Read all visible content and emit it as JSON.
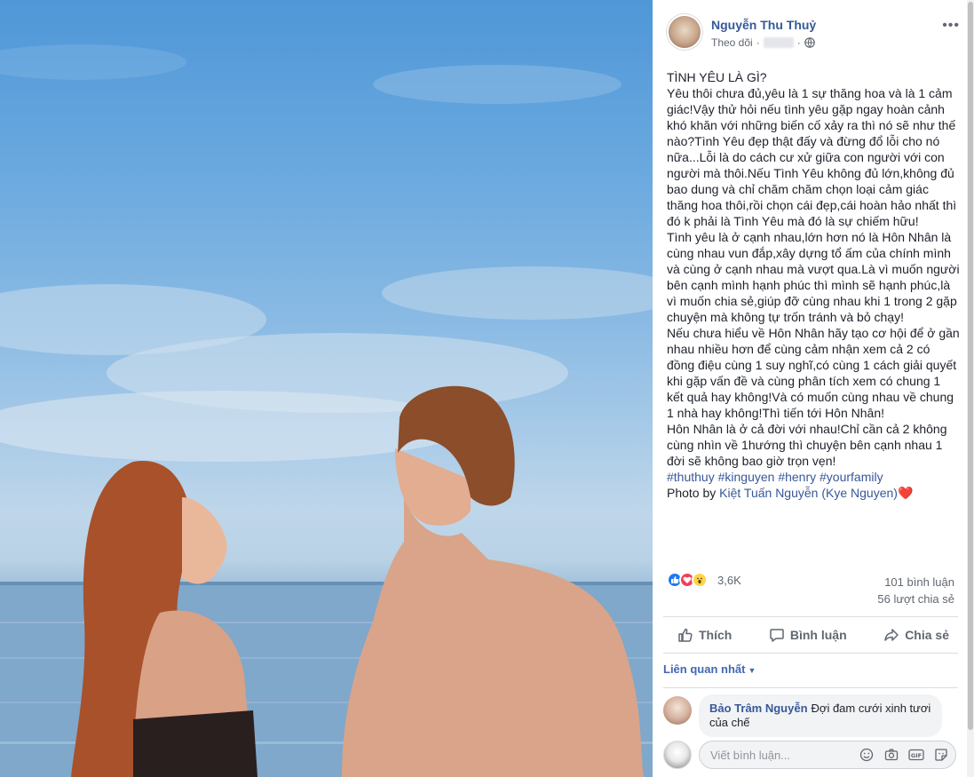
{
  "post": {
    "author": "Nguyễn Thu Thuỷ",
    "follow_label": "Theo dõi",
    "text": {
      "title": "TÌNH YÊU LÀ GÌ?",
      "p1": "Yêu thôi chưa đủ,yêu là 1 sự thăng hoa và là 1 cảm giác!Vậy thử hỏi nếu tình yêu gặp ngay hoàn cảnh khó khăn với những biến cố xảy ra thì nó sẽ như thế nào?Tình Yêu đẹp thật đấy và đừng đổ lỗi cho nó nữa...Lỗi là do cách cư xử giữa con người với con người mà thôi.Nếu Tình Yêu không đủ lớn,không đủ bao dung và chỉ chăm chăm chọn loại cảm giác thăng hoa thôi,rồi chọn cái đẹp,cái hoàn hảo nhất thì đó k phải là Tình Yêu mà đó là sự chiếm hữu!",
      "p2": "Tình yêu là ở cạnh nhau,lớn hơn nó là Hôn Nhân là cùng nhau vun đắp,xây dựng tổ ấm của chính mình và cùng ở cạnh nhau mà vượt qua.Là vì muốn người bên cạnh mình hạnh phúc thì mình sẽ hạnh phúc,là vì muốn chia sẻ,giúp đỡ cùng nhau khi 1 trong 2 gặp chuyện mà không tự trốn tránh và bỏ chạy!",
      "p3": "Nếu chưa hiểu về Hôn Nhân hãy tạo cơ hội để ở gần nhau nhiều hơn để cùng cảm nhận xem cả 2 có đồng điệu cùng 1 suy nghĩ,có cùng 1 cách giải quyết khi gặp vấn đề và cùng phân tích xem có chung 1 kết quả hay không!Và có muốn cùng nhau về chung 1 nhà hay không!Thì tiến tới Hôn Nhân!",
      "p4": "Hôn Nhân là ở cả đời với nhau!Chỉ cần cả 2 không cùng nhìn về 1hướng thì chuyện bên cạnh nhau 1 đời sẽ không bao giờ trọn vẹn!",
      "hashtags": "#thuthuy #kinguyen #henry #yourfamily",
      "photo_by_prefix": "Photo by ",
      "photo_by_name": "Kiệt Tuấn Nguyễn (Kye Nguyen)",
      "heart": "❤️"
    },
    "reactions_count": "3,6K",
    "comments_count": "101 bình luận",
    "shares_count": "56 lượt chia sẻ"
  },
  "actions": {
    "like": "Thích",
    "comment": "Bình luận",
    "share": "Chia sẻ"
  },
  "comments": {
    "sort_label": "Liên quan nhất",
    "items": [
      {
        "author": "Bảo Trâm Nguyễn",
        "text": "Đợi đam cưới xinh tươi của chế"
      }
    ],
    "input_placeholder": "Viết bình luận..."
  },
  "colors": {
    "link": "#365899",
    "like_blue": "#2078f4",
    "love_red": "#f33e58",
    "wow_yellow": "#fcd54c"
  },
  "icons": [
    "globe-icon",
    "more-icon",
    "like-icon",
    "comment-icon",
    "share-icon",
    "emoji-icon",
    "camera-icon",
    "gif-icon",
    "sticker-icon"
  ]
}
